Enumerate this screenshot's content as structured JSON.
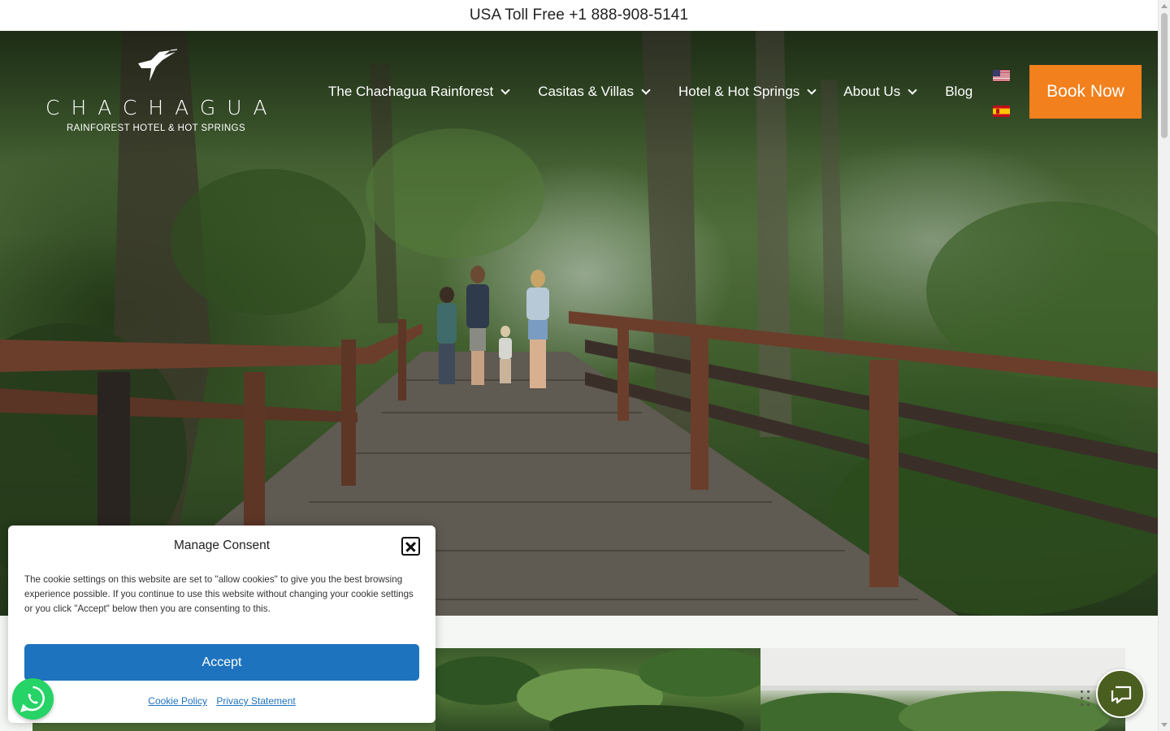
{
  "topbar": {
    "text": "USA Toll Free +1 888-908-5141"
  },
  "logo": {
    "wordmark": "CHACHAGUA",
    "tagline": "RAINFOREST HOTEL & HOT SPRINGS",
    "icon": "hummingbird-logo-icon"
  },
  "nav": {
    "items": [
      {
        "label": "The Chachagua Rainforest",
        "has_dropdown": true
      },
      {
        "label": "Casitas & Villas",
        "has_dropdown": true
      },
      {
        "label": "Hotel & Hot Springs",
        "has_dropdown": true
      },
      {
        "label": "About Us",
        "has_dropdown": true
      },
      {
        "label": "Blog",
        "has_dropdown": false
      }
    ],
    "languages": [
      "us-flag-icon",
      "es-flag-icon"
    ],
    "book_label": "Book Now"
  },
  "consent": {
    "title": "Manage Consent",
    "message": "The cookie settings on this website are set to \"allow cookies\" to give you the best browsing experience possible. If you continue to use this website without changing your cookie settings or you click \"Accept\" below then you are consenting to this.",
    "accept_label": "Accept",
    "cookie_policy_label": "Cookie Policy",
    "privacy_label": "Privacy Statement"
  },
  "widgets": {
    "chat_icon": "chat-bubble-icon",
    "whatsapp_icon": "whatsapp-icon"
  },
  "colors": {
    "book_button": "#f2801d",
    "accept_button": "#1e73be",
    "chat_button": "#4a5e1f",
    "whatsapp": "#25d366"
  }
}
